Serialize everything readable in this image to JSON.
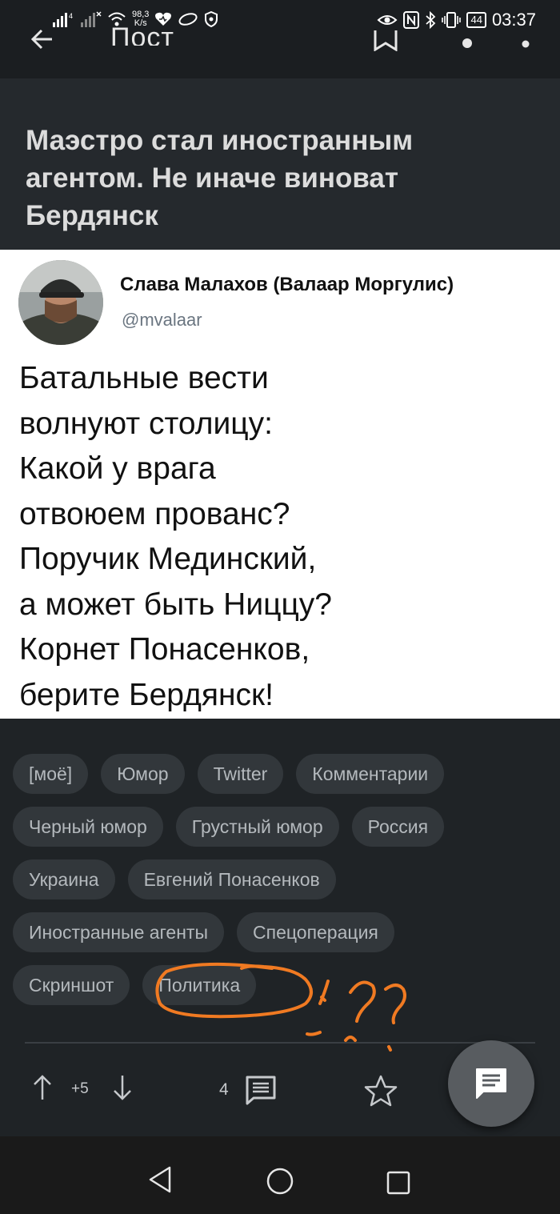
{
  "status_bar": {
    "net_speed_value": "98,3",
    "net_speed_unit": "K/s",
    "battery": "44",
    "time": "03:37"
  },
  "app_bar": {
    "title": "Пост"
  },
  "post": {
    "title": "Маэстро стал иностранным агентом. Не иначе виноват Бердянск"
  },
  "tweet": {
    "author_name": "Слава Малахов (Валаар Моргулис)",
    "author_handle": "@mvalaar",
    "lines": [
      "Батальные вести",
      "волнуют столицу:",
      "Какой у врага",
      "отвоюем прованс?",
      "Поручик Мединский,",
      "а может быть Ниццу?",
      "Корнет Понасенков,",
      "берите Бердянск!"
    ]
  },
  "tags": {
    "rows": [
      [
        "[моё]",
        "Юмор",
        "Twitter",
        "Комментарии"
      ],
      [
        "Черный юмор",
        "Грустный юмор",
        "Россия"
      ],
      [
        "Украина",
        "Евгений Понасенков"
      ],
      [
        "Иностранные агенты",
        "Спецоперация"
      ],
      [
        "Скриншот",
        "Политика"
      ]
    ]
  },
  "annotation": {
    "color": "#f07a22"
  },
  "actions": {
    "score": "+5",
    "comment_count": "4"
  },
  "colors": {
    "background": "#1f2326",
    "tag_background": "#32373b",
    "tag_text": "#b4b9bd"
  }
}
